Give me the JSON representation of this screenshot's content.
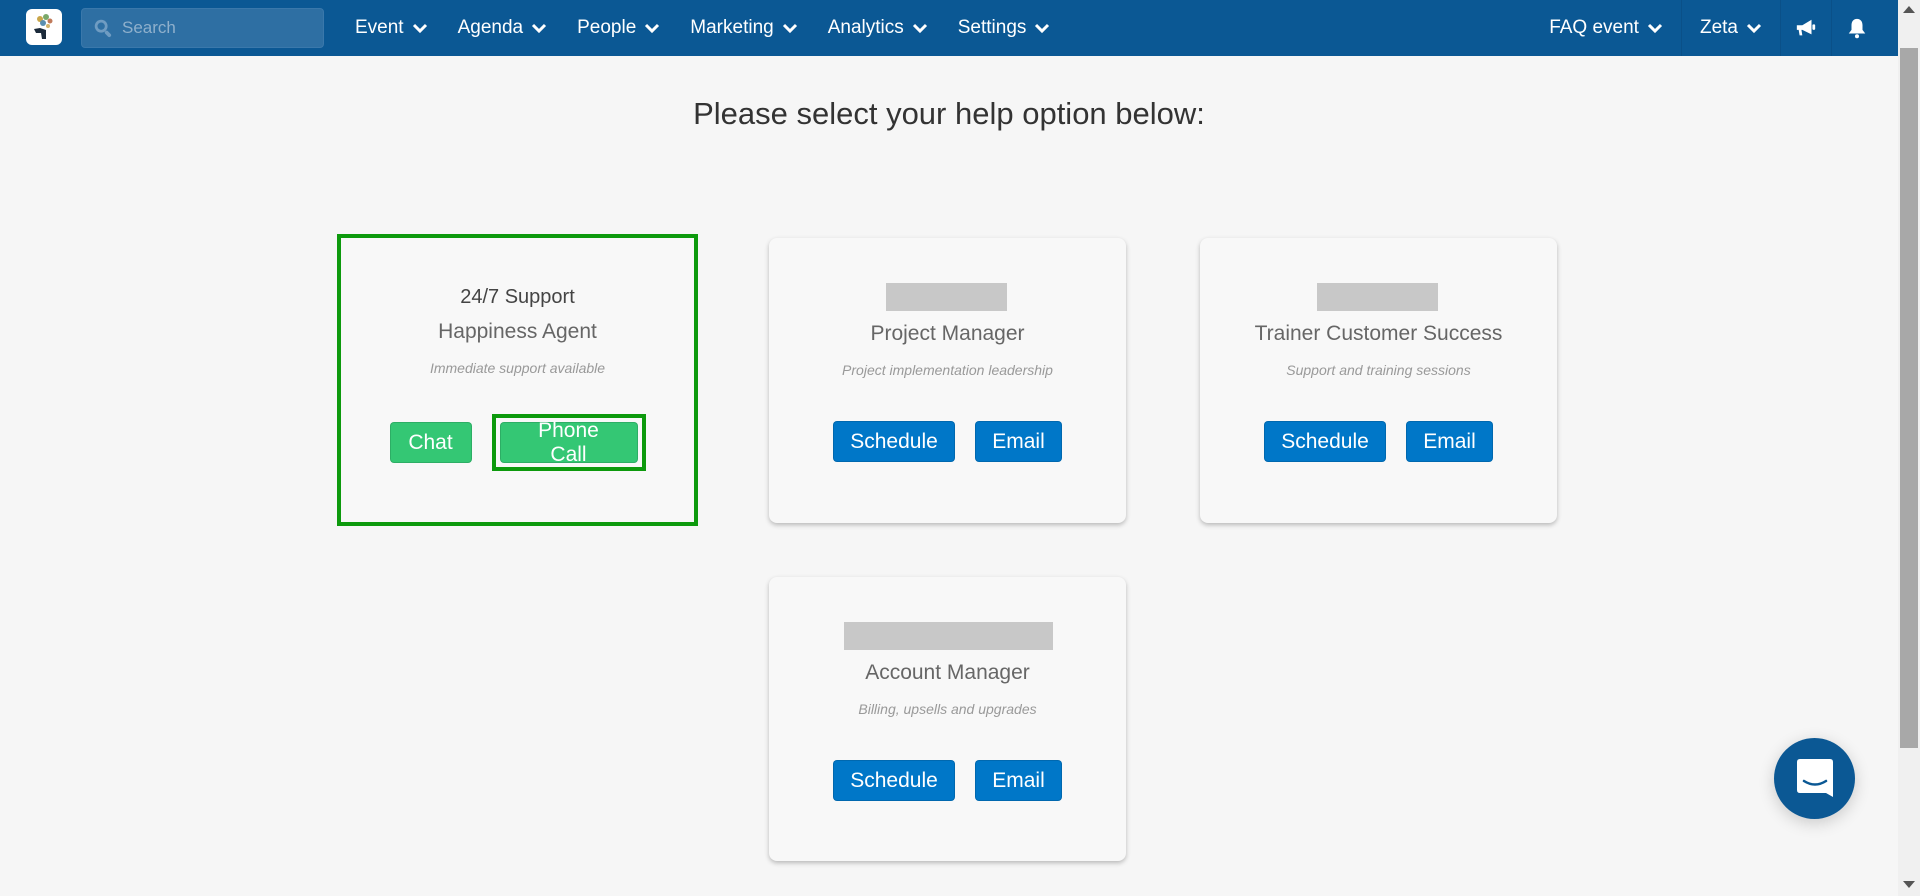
{
  "navbar": {
    "logo_alt": "App logo",
    "search": {
      "placeholder": "Search",
      "value": ""
    },
    "menu": [
      {
        "label": "Event"
      },
      {
        "label": "Agenda"
      },
      {
        "label": "People"
      },
      {
        "label": "Marketing"
      },
      {
        "label": "Analytics"
      },
      {
        "label": "Settings"
      }
    ],
    "right": {
      "event_selector": "FAQ event",
      "user_menu": "Zeta",
      "announcements_icon": "megaphone-icon",
      "notifications_icon": "bell-icon"
    }
  },
  "main": {
    "title": "Please select your help option below:",
    "cards": [
      {
        "heading": "24/7 Support",
        "role": "Happiness Agent",
        "description": "Immediate support available",
        "buttons": [
          "Chat",
          "Phone Call"
        ],
        "highlighted": true
      },
      {
        "heading_redacted": true,
        "role": "Project Manager",
        "description": "Project implementation leadership",
        "buttons": [
          "Schedule",
          "Email"
        ]
      },
      {
        "heading_redacted": true,
        "role": "Trainer Customer Success",
        "description": "Support and training sessions",
        "buttons": [
          "Schedule",
          "Email"
        ]
      },
      {
        "heading_redacted": true,
        "role": "Account Manager",
        "description": "Billing, upsells and upgrades",
        "buttons": [
          "Schedule",
          "Email"
        ]
      }
    ]
  },
  "chat_launcher": {
    "icon": "chat-bubble-icon"
  },
  "colors": {
    "navbar": "#0b5894",
    "green_button": "#34c774",
    "blue_button": "#0077c8",
    "highlight_border": "#0d9a0d",
    "background": "#f6f6f6"
  }
}
